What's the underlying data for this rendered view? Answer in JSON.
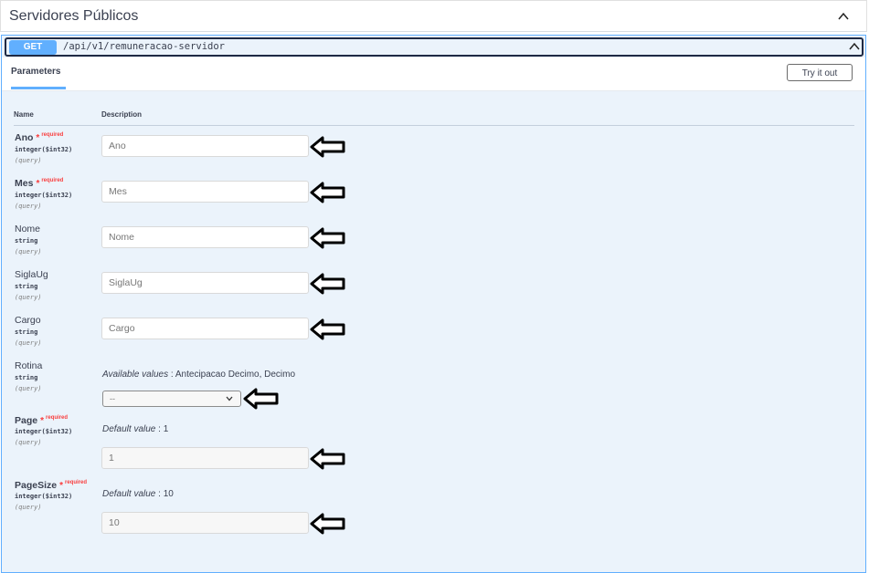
{
  "tag": {
    "title": "Servidores Públicos"
  },
  "operation": {
    "method": "GET",
    "path": "/api/v1/remuneracao-servidor",
    "method_color": "#61affe"
  },
  "section": {
    "tab_label": "Parameters",
    "try_label": "Try it out"
  },
  "columns": {
    "name": "Name",
    "description": "Description"
  },
  "params": [
    {
      "name": "Ano",
      "required": "*",
      "required_text": "required",
      "type": "integer($int32)",
      "in": "(query)",
      "placeholder": "Ano"
    },
    {
      "name": "Mes",
      "required": "*",
      "required_text": "required",
      "type": "integer($int32)",
      "in": "(query)",
      "placeholder": "Mes"
    },
    {
      "name": "Nome",
      "type": "string",
      "in": "(query)",
      "placeholder": "Nome"
    },
    {
      "name": "SiglaUg",
      "type": "string",
      "in": "(query)",
      "placeholder": "SiglaUg"
    },
    {
      "name": "Cargo",
      "type": "string",
      "in": "(query)",
      "placeholder": "Cargo"
    },
    {
      "name": "Rotina",
      "type": "string",
      "in": "(query)",
      "available_label": "Available values",
      "available_values": ": Antecipacao Decimo, Decimo",
      "selected": "--"
    },
    {
      "name": "Page",
      "required": "*",
      "required_text": "required",
      "type": "integer($int32)",
      "in": "(query)",
      "default_label": "Default value",
      "default_value": ": 1",
      "value": "1"
    },
    {
      "name": "PageSize",
      "required": "*",
      "required_text": "required",
      "type": "integer($int32)",
      "in": "(query)",
      "default_label": "Default value",
      "default_value": ": 10",
      "value": "10"
    }
  ]
}
